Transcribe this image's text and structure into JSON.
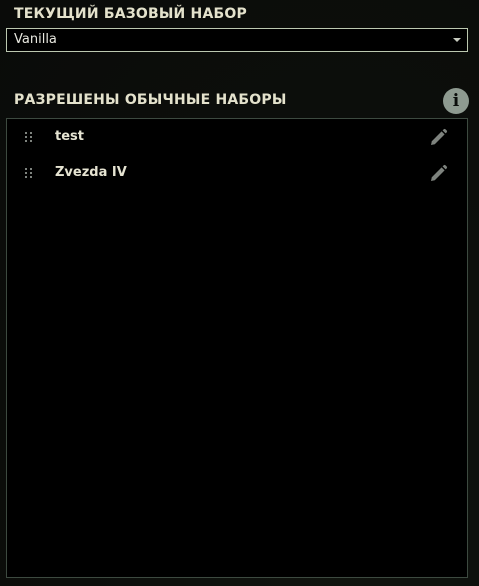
{
  "current_base_set": {
    "title": "ТЕКУЩИЙ БАЗОВЫЙ НАБОР",
    "selected": "Vanilla"
  },
  "allowed_sets": {
    "title": "РАЗРЕШЕНЫ ОБЫЧНЫЕ НАБОРЫ",
    "info_icon": "i",
    "items": [
      {
        "label": "test"
      },
      {
        "label": "Zvezda IV"
      }
    ]
  },
  "icons": {
    "drag": "drag-handle-icon",
    "edit": "pencil-icon",
    "info": "info-icon",
    "dropdown": "chevron-down-icon"
  },
  "colors": {
    "title_text": "#e4e2cc",
    "item_text": "#e6e4d2",
    "dropdown_border": "#bcc8b0",
    "panel_border": "#3d4a40",
    "info_bg": "#8e9a90",
    "icon_gray": "#7e837e"
  }
}
